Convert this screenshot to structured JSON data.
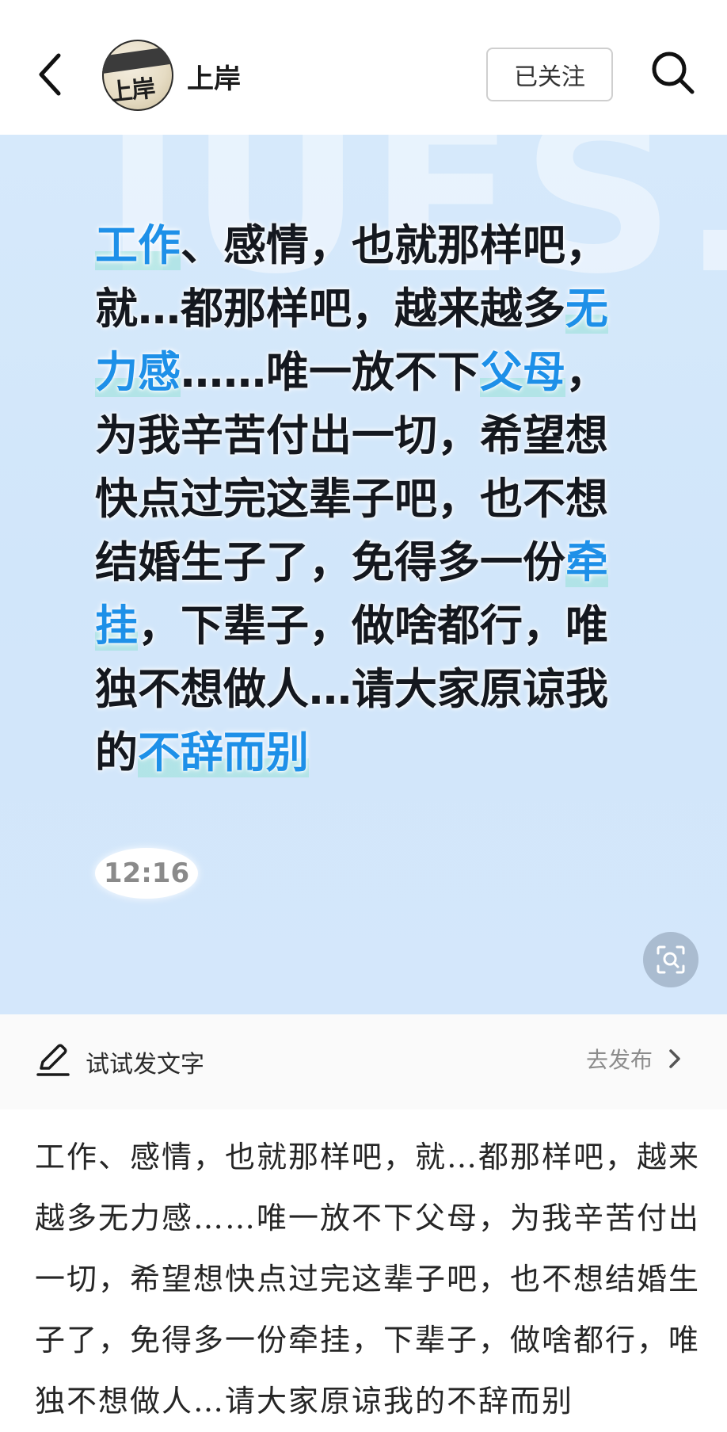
{
  "header": {
    "username": "上岸",
    "avatar_text": "上岸",
    "follow_label": "已关注",
    "back_icon": "chevron-left-icon",
    "search_icon": "search-icon"
  },
  "post_image": {
    "watermark": "IUES.",
    "text_segments": [
      {
        "text": "工作",
        "highlight": true
      },
      {
        "text": "、感情，也就那样吧，就…都那样吧，越来越多",
        "highlight": false
      },
      {
        "text": "无力感",
        "highlight": true
      },
      {
        "text": "……唯一放不下",
        "highlight": false
      },
      {
        "text": "父母",
        "highlight": true
      },
      {
        "text": "，为我辛苦付出一切，希望想快点过完这辈子吧，也不想结婚生子了，免得多一份",
        "highlight": false
      },
      {
        "text": "牵挂",
        "highlight": true
      },
      {
        "text": "，下辈子，做啥都行，唯独不想做人…请大家原谅我的",
        "highlight": false
      },
      {
        "text": "不辞而别",
        "highlight": true
      }
    ],
    "time": "12:16",
    "scan_icon": "image-search-icon",
    "highlight_color": "#1e90e8"
  },
  "compose": {
    "label": "试试发文字",
    "publish_label": "去发布",
    "pencil_icon": "pencil-icon",
    "chevron_icon": "chevron-right-icon"
  },
  "body": {
    "text": "工作、感情，也就那样吧，就…都那样吧，越来越多无力感……唯一放不下父母，为我辛苦付出一切，希望想快点过完这辈子吧，也不想结婚生子了，免得多一份牵挂，下辈子，做啥都行，唯独不想做人…请大家原谅我的不辞而别"
  }
}
